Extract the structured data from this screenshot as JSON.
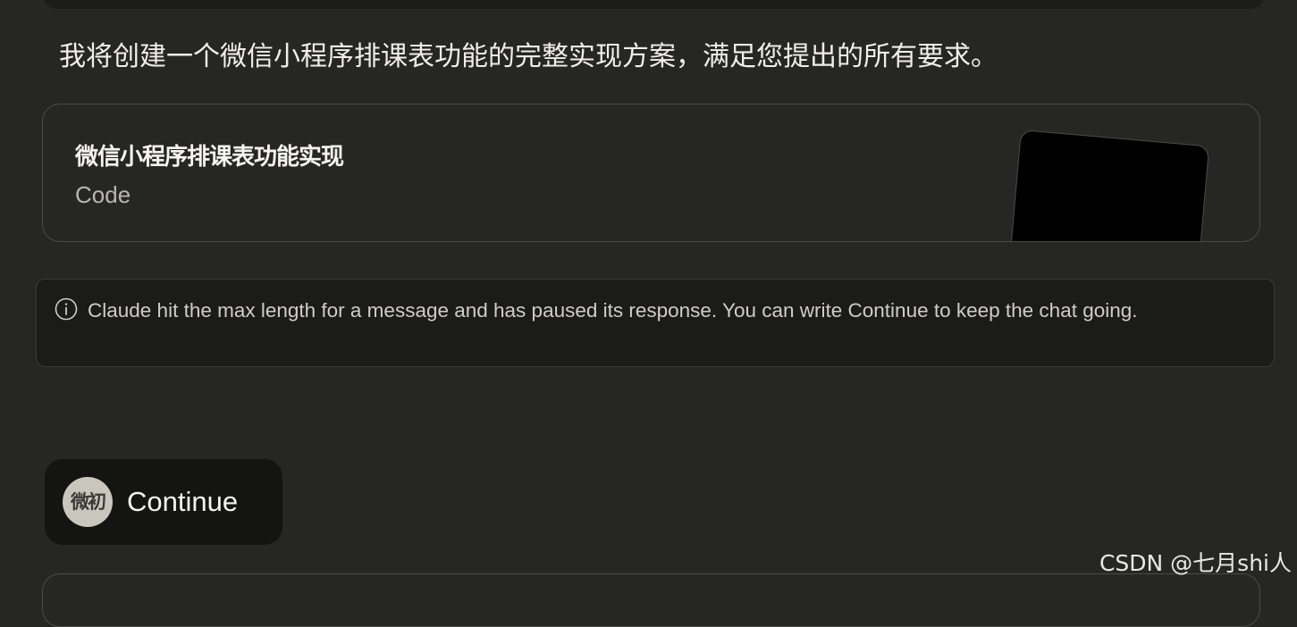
{
  "assistant": {
    "intro": "我将创建一个微信小程序排课表功能的完整实现方案，满足您提出的所有要求。",
    "artifact": {
      "title": "微信小程序排课表功能实现",
      "type_label": "Code"
    },
    "notice": {
      "icon": "info-icon",
      "text": "Claude hit the max length for a message and has paused its response. You can write Continue to keep the chat going."
    }
  },
  "user_message": {
    "avatar_text": "微初",
    "text": "Continue"
  },
  "watermark": "CSDN @七月shi人"
}
